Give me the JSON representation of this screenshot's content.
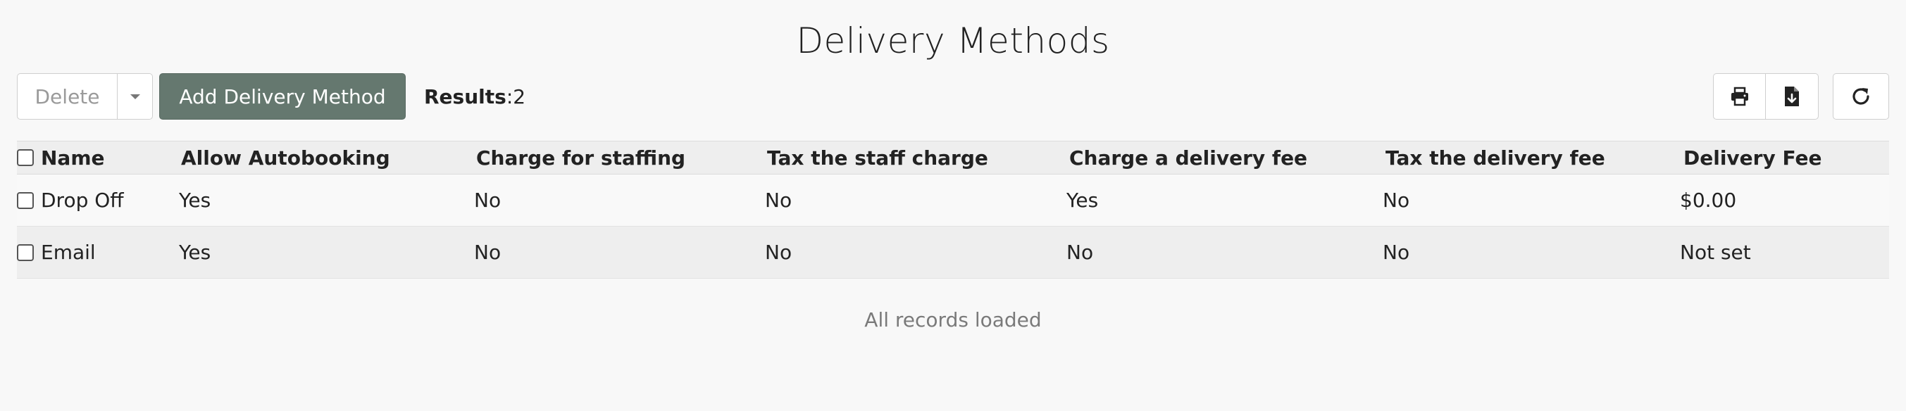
{
  "page": {
    "title": "Delivery Methods"
  },
  "toolbar": {
    "delete_label": "Delete",
    "add_label": "Add Delivery Method",
    "results_label": "Results",
    "results_sep": ": ",
    "results_count": "2",
    "icons": [
      "print-icon",
      "download-file-icon",
      "refresh-icon"
    ]
  },
  "table": {
    "columns": [
      "Name",
      "Allow Autobooking",
      "Charge for staffing",
      "Tax the staff charge",
      "Charge a delivery fee",
      "Tax the delivery fee",
      "Delivery Fee"
    ],
    "rows": [
      [
        "Drop Off",
        "Yes",
        "No",
        "No",
        "Yes",
        "No",
        "$0.00"
      ],
      [
        "Email",
        "Yes",
        "No",
        "No",
        "No",
        "No",
        "Not set"
      ]
    ]
  },
  "footer": {
    "status": "All records loaded"
  },
  "colors": {
    "accent": "#65786f",
    "background": "#f8f8f8",
    "header_bg": "#eeeeee"
  }
}
